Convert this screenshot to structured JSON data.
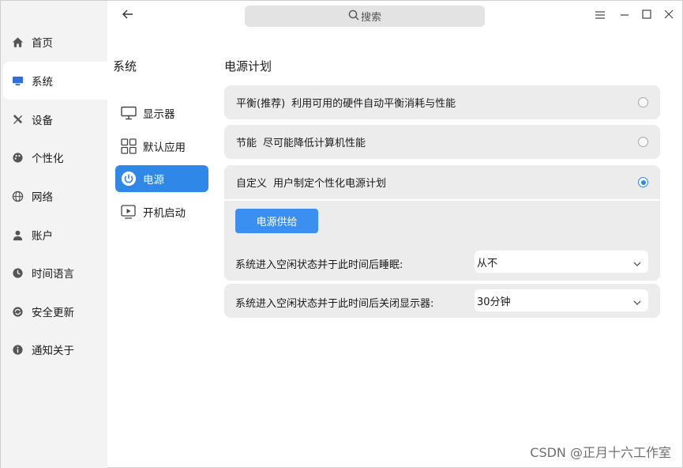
{
  "window": {
    "search_placeholder": "搜索",
    "controls": [
      "menu",
      "minimize",
      "maximize",
      "close"
    ]
  },
  "left_nav": {
    "items": [
      {
        "label": "首页",
        "icon": "home-icon",
        "active": false
      },
      {
        "label": "系统",
        "icon": "monitor-icon",
        "active": true
      },
      {
        "label": "设备",
        "icon": "tools-icon",
        "active": false
      },
      {
        "label": "个性化",
        "icon": "palette-icon",
        "active": false
      },
      {
        "label": "网络",
        "icon": "globe-icon",
        "active": false
      },
      {
        "label": "账户",
        "icon": "user-icon",
        "active": false
      },
      {
        "label": "时间语言",
        "icon": "clock-icon",
        "active": false
      },
      {
        "label": "安全更新",
        "icon": "shield-icon",
        "active": false
      },
      {
        "label": "通知关于",
        "icon": "info-icon",
        "active": false
      }
    ]
  },
  "section": {
    "title": "系统",
    "items": [
      {
        "label": "显示器",
        "icon": "display-icon",
        "active": false
      },
      {
        "label": "默认应用",
        "icon": "grid-icon",
        "active": false
      },
      {
        "label": "电源",
        "icon": "power-icon",
        "active": true
      },
      {
        "label": "开机启动",
        "icon": "startup-icon",
        "active": false
      }
    ]
  },
  "main": {
    "title": "电源计划",
    "plans": [
      {
        "name": "平衡(推荐)",
        "desc": "利用可用的硬件自动平衡消耗与性能",
        "selected": false
      },
      {
        "name": "节能",
        "desc": "尽可能降低计算机性能",
        "selected": false
      },
      {
        "name": "自定义",
        "desc": "用户制定个性化电源计划",
        "selected": true
      }
    ],
    "supply_tab": "电源供给",
    "settings": [
      {
        "label": "系统进入空闲状态并于此时间后睡眠:",
        "value": "从不"
      },
      {
        "label": "系统进入空闲状态并于此时间后关闭显示器:",
        "value": "30分钟"
      }
    ]
  },
  "watermark": "CSDN @正月十六工作室",
  "colors": {
    "accent": "#2f87e8",
    "nav_bg": "#f3f3f3",
    "card_bg": "#ececec"
  }
}
